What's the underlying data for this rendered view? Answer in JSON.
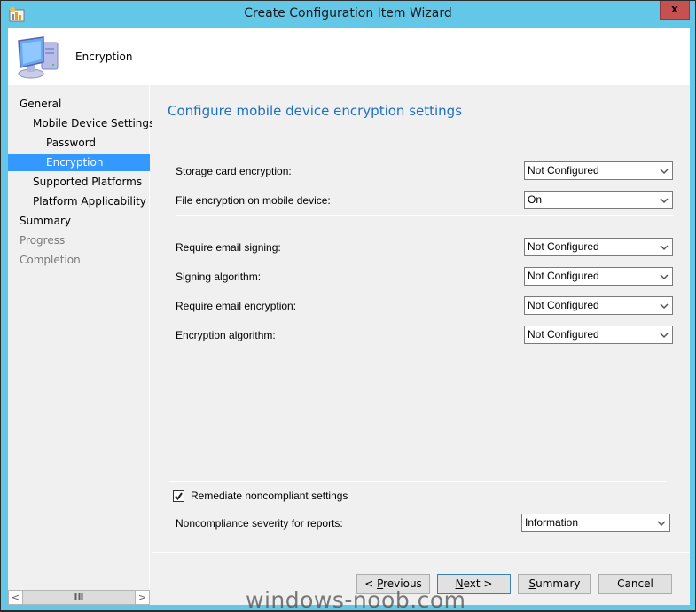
{
  "window": {
    "title": "Create Configuration Item Wizard",
    "close_label": "x",
    "accent": "#63c8e8"
  },
  "header": {
    "title": "Encryption",
    "icon": "computer-icon"
  },
  "nav": {
    "items": [
      {
        "label": "General",
        "level": 0,
        "state": "normal"
      },
      {
        "label": "Mobile Device Settings",
        "level": 1,
        "state": "normal"
      },
      {
        "label": "Password",
        "level": 2,
        "state": "normal"
      },
      {
        "label": "Encryption",
        "level": 2,
        "state": "selected"
      },
      {
        "label": "Supported Platforms",
        "level": 1,
        "state": "normal"
      },
      {
        "label": "Platform Applicability",
        "level": 1,
        "state": "normal"
      },
      {
        "label": "Summary",
        "level": 0,
        "state": "normal"
      },
      {
        "label": "Progress",
        "level": 0,
        "state": "disabled"
      },
      {
        "label": "Completion",
        "level": 0,
        "state": "disabled"
      }
    ],
    "scroll_left": "<",
    "scroll_right": ">"
  },
  "main": {
    "heading": "Configure mobile device encryption settings",
    "settings": [
      {
        "label": "Storage card encryption:",
        "value": "Not Configured"
      },
      {
        "label": "File encryption on mobile device:",
        "value": "On"
      },
      {
        "label": "Require email signing:",
        "value": "Not Configured"
      },
      {
        "label": "Signing algorithm:",
        "value": "Not Configured"
      },
      {
        "label": "Require email encryption:",
        "value": "Not Configured"
      },
      {
        "label": "Encryption algorithm:",
        "value": "Not Configured"
      }
    ],
    "remediate": {
      "label": "Remediate noncompliant settings",
      "checked": true
    },
    "severity": {
      "label": "Noncompliance severity for reports:",
      "value": "Information"
    }
  },
  "buttons": {
    "previous": {
      "prefix": "< ",
      "accel": "P",
      "rest": "revious"
    },
    "next": {
      "accel": "N",
      "rest": "ext >"
    },
    "summary": {
      "accel": "S",
      "rest": "ummary"
    },
    "cancel": "Cancel"
  },
  "watermark": "windows-noob.com"
}
